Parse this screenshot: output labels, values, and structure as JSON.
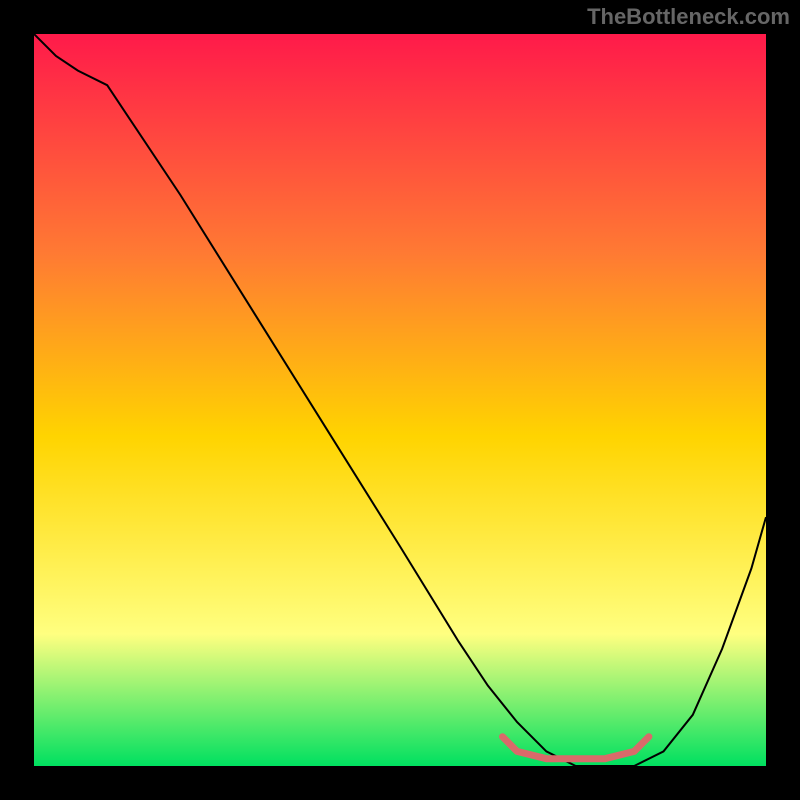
{
  "watermark": "TheBottleneck.com",
  "chart_data": {
    "type": "line",
    "title": "",
    "xlabel": "",
    "ylabel": "",
    "xlim": [
      0,
      100
    ],
    "ylim": [
      0,
      100
    ],
    "background_gradient": {
      "top_color": "#ff1a4a",
      "mid_upper_color": "#ff7a33",
      "mid_color": "#ffd400",
      "mid_lower_color": "#ffff80",
      "bottom_color": "#00e060"
    },
    "series": [
      {
        "name": "bottleneck-curve",
        "color": "#000000",
        "stroke_width": 2,
        "x": [
          0,
          3,
          6,
          10,
          20,
          30,
          40,
          50,
          58,
          62,
          66,
          70,
          74,
          78,
          82,
          86,
          90,
          94,
          98,
          100
        ],
        "y": [
          100,
          97,
          95,
          93,
          78,
          62,
          46,
          30,
          17,
          11,
          6,
          2,
          0,
          0,
          0,
          2,
          7,
          16,
          27,
          34
        ]
      },
      {
        "name": "optimal-range-marker",
        "color": "#d96a6a",
        "stroke_width": 7,
        "x": [
          64,
          66,
          70,
          74,
          78,
          82,
          84
        ],
        "y": [
          4,
          2,
          1,
          1,
          1,
          2,
          4
        ]
      }
    ],
    "optimal_range": {
      "x_start": 64,
      "x_end": 84
    }
  }
}
